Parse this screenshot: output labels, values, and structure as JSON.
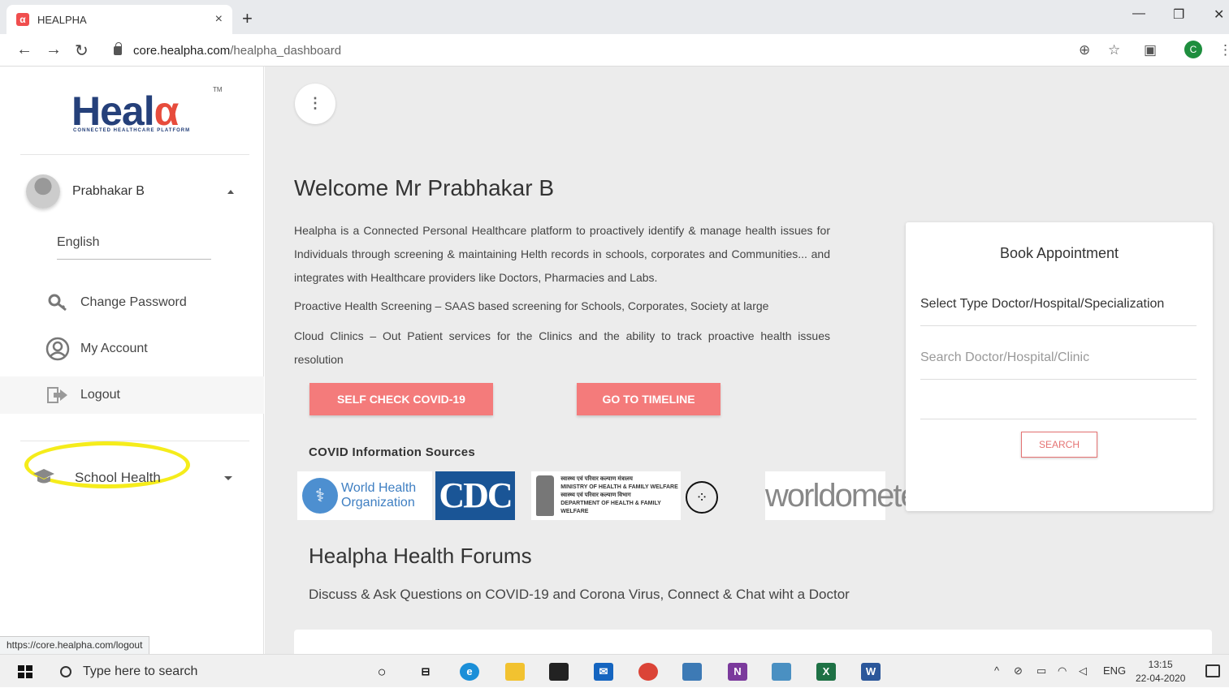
{
  "browser": {
    "tab_title": "HEALPHA",
    "tab_close": "×",
    "new_tab": "+",
    "url_domain": "core.healpha.com",
    "url_path": "/healpha_dashboard",
    "profile_initial": "C",
    "status_url": "https://core.healpha.com/logout"
  },
  "sidebar": {
    "logo_main": "Heal",
    "logo_alpha": "α",
    "logo_tm": "TM",
    "logo_tagline": "CONNECTED HEALTHCARE PLATFORM",
    "user_name": "Prabhakar B",
    "language": "English",
    "menu": [
      {
        "label": "Change Password",
        "icon": "key-search-icon"
      },
      {
        "label": "My Account",
        "icon": "account-icon"
      },
      {
        "label": "Logout",
        "icon": "logout-icon"
      }
    ],
    "school_health": "School Health"
  },
  "main": {
    "welcome": "Welcome Mr Prabhakar B",
    "para1": "Healpha is a Connected Personal Healthcare platform to proactively identify & manage health issues for Individuals through screening & maintaining Helth records in schools, corporates and Communities... and integrates with Healthcare providers like Doctors, Pharmacies and Labs.",
    "para2": "Proactive Health Screening – SAAS based screening for Schools, Corporates, Society at large",
    "para3": "Cloud Clinics – Out Patient services for the Clinics and the ability to track proactive health issues resolution",
    "btn_covid": "SELF CHECK COVID-19",
    "btn_timeline": "GO TO TIMELINE",
    "covid_sources_heading": "COVID Information Sources",
    "sources": {
      "who_line1": "World Health",
      "who_line2": "Organization",
      "cdc": "CDC",
      "mohfw_line1": "स्वास्थ्य एवं परिवार कल्याण मंत्रालय",
      "mohfw_line2": "MINISTRY OF HEALTH & FAMILY WELFARE",
      "mohfw_line3": "स्वास्थ्य एवं परिवार कल्याण विभाग",
      "mohfw_line4": "DEPARTMENT OF HEALTH & FAMILY WELFARE",
      "worldometer": "worldometer"
    },
    "forums_title": "Healpha Health Forums",
    "forums_desc": "Discuss & Ask Questions on COVID-19 and Corona Virus, Connect & Chat wiht a Doctor"
  },
  "appointment": {
    "title": "Book Appointment",
    "select_type": "Select Type Doctor/Hospital/Specialization",
    "search_placeholder": "Search Doctor/Hospital/Clinic",
    "search_btn": "SEARCH"
  },
  "taskbar": {
    "search_placeholder": "Type here to search",
    "lang": "ENG",
    "time": "13:15",
    "date": "22-04-2020"
  },
  "colors": {
    "accent_red": "#f47b7b",
    "brand_navy": "#25407a",
    "highlight_yellow": "#f5ec1b"
  }
}
